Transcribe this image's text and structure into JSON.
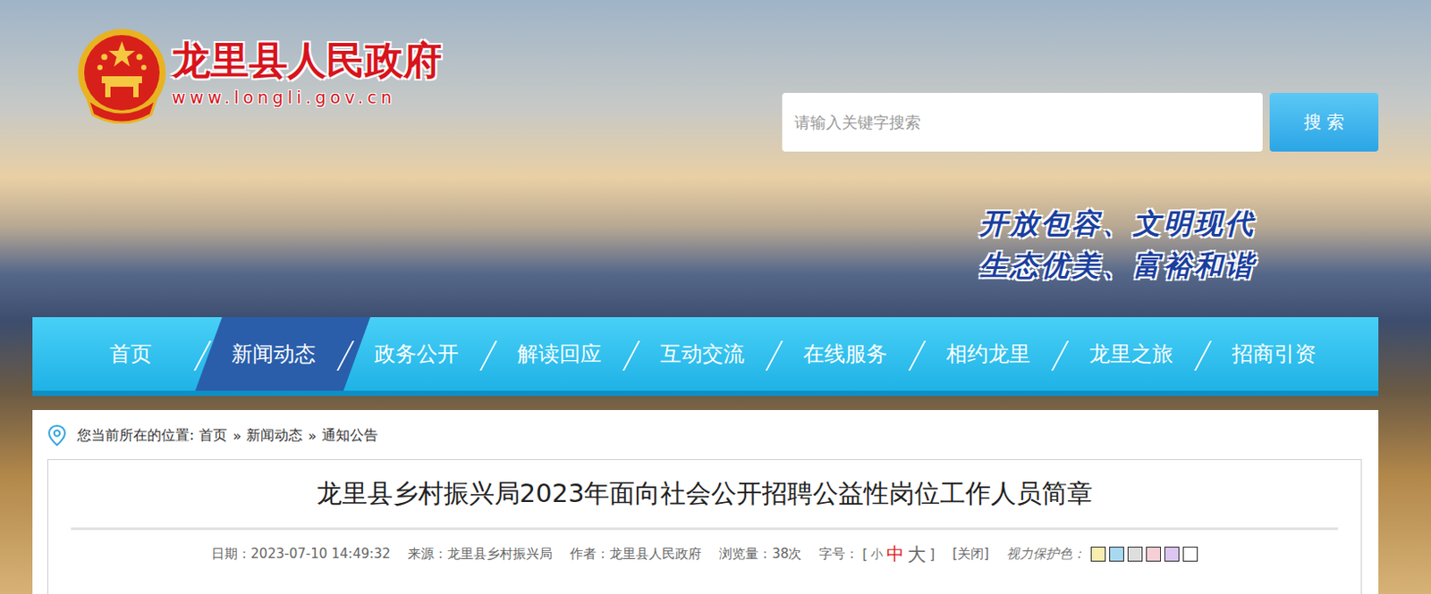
{
  "site": {
    "name": "龙里县人民政府",
    "url": "www.longli.gov.cn"
  },
  "search": {
    "placeholder": "请输入关键字搜索",
    "button": "搜 索"
  },
  "slogan": [
    "开放包容、文明现代",
    "生态优美、富裕和谐"
  ],
  "nav": [
    {
      "label": "首页",
      "selected": false
    },
    {
      "label": "新闻动态",
      "selected": true
    },
    {
      "label": "政务公开",
      "selected": false
    },
    {
      "label": "解读回应",
      "selected": false
    },
    {
      "label": "互动交流",
      "selected": false
    },
    {
      "label": "在线服务",
      "selected": false
    },
    {
      "label": "相约龙里",
      "selected": false
    },
    {
      "label": "龙里之旅",
      "selected": false
    },
    {
      "label": "招商引资",
      "selected": false
    }
  ],
  "breadcrumb": {
    "label": "您当前所在的位置:",
    "items": [
      "首页",
      "新闻动态",
      "通知公告"
    ],
    "separator": "»"
  },
  "article": {
    "title": "龙里县乡村振兴局2023年面向社会公开招聘公益性岗位工作人员简章",
    "meta": [
      "日期：2023-07-10 14:49:32",
      "来源：龙里县乡村振兴局",
      "作者：龙里县人民政府",
      "浏览量：38次"
    ]
  },
  "font_size": {
    "label": "字号：",
    "open": "[",
    "close": "]",
    "options": [
      {
        "label": "小",
        "selected": false
      },
      {
        "label": "中",
        "selected": true
      },
      {
        "label": "大",
        "selected": false
      }
    ]
  },
  "close": "[关闭]",
  "eye_care": {
    "label": "视力保护色：",
    "swatches": [
      {
        "color": "#f7eeb0"
      },
      {
        "color": "#a9d9f2"
      },
      {
        "color": "#dedede"
      },
      {
        "color": "#f6cfd6"
      },
      {
        "color": "#ddc6f2"
      },
      {
        "color": "#ffffff"
      }
    ]
  }
}
